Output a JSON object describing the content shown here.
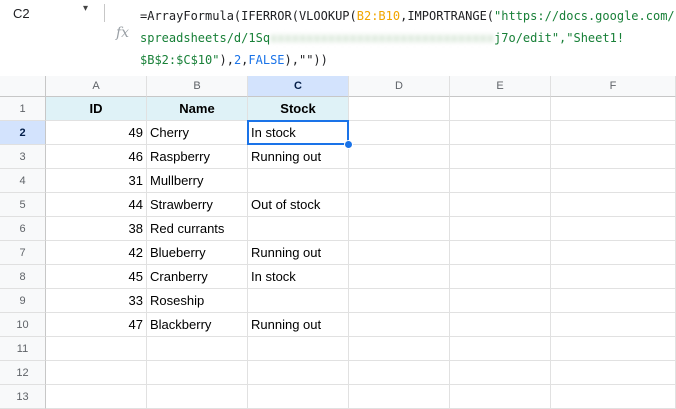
{
  "namebox": {
    "cell_ref": "C2",
    "caret": "▾"
  },
  "formula_bar": {
    "fx_label": "fx",
    "line1": [
      {
        "t": "=ArrayFormula(IFERROR(VLOOKUP(",
        "c": ""
      },
      {
        "t": "B2:B10",
        "c": "range"
      },
      {
        "t": ",IMPORTRANGE(",
        "c": ""
      },
      {
        "t": "\"https://docs.google.com/",
        "c": "str"
      }
    ],
    "line2": [
      {
        "t": "spreadsheets/d/1Sq",
        "c": "str"
      },
      {
        "t": "xxxxxxxxxxxxxxxxxxxxxxxxxxxxxxx",
        "c": "blur"
      },
      {
        "t": "j7o/edit\",\"Sheet1!",
        "c": "str"
      }
    ],
    "line3": [
      {
        "t": "$B$2:$C$10\"",
        "c": "str"
      },
      {
        "t": "),",
        "c": ""
      },
      {
        "t": "2",
        "c": "num"
      },
      {
        "t": ",",
        "c": ""
      },
      {
        "t": "FALSE",
        "c": "num"
      },
      {
        "t": "),\"\"))",
        "c": ""
      }
    ]
  },
  "columns": [
    "A",
    "B",
    "C",
    "D",
    "E",
    "F"
  ],
  "selected_column": "C",
  "selected_row": 2,
  "rows": [
    1,
    2,
    3,
    4,
    5,
    6,
    7,
    8,
    9,
    10,
    11,
    12,
    13
  ],
  "headers": {
    "id": "ID",
    "name": "Name",
    "stock": "Stock"
  },
  "data_rows": [
    {
      "id": "49",
      "name": "Cherry",
      "stock": "In stock"
    },
    {
      "id": "46",
      "name": "Raspberry",
      "stock": "Running out"
    },
    {
      "id": "31",
      "name": "Mullberry",
      "stock": ""
    },
    {
      "id": "44",
      "name": "Strawberry",
      "stock": "Out of stock"
    },
    {
      "id": "38",
      "name": "Red currants",
      "stock": ""
    },
    {
      "id": "42",
      "name": "Blueberry",
      "stock": "Running out"
    },
    {
      "id": "45",
      "name": "Cranberry",
      "stock": "In stock"
    },
    {
      "id": "33",
      "name": "Roseship",
      "stock": ""
    },
    {
      "id": "47",
      "name": "Blackberry",
      "stock": "Running out"
    }
  ],
  "colors": {
    "accent": "#1a73e8",
    "header_fill": "#dff2f7",
    "selected_header": "#d3e3fd"
  }
}
